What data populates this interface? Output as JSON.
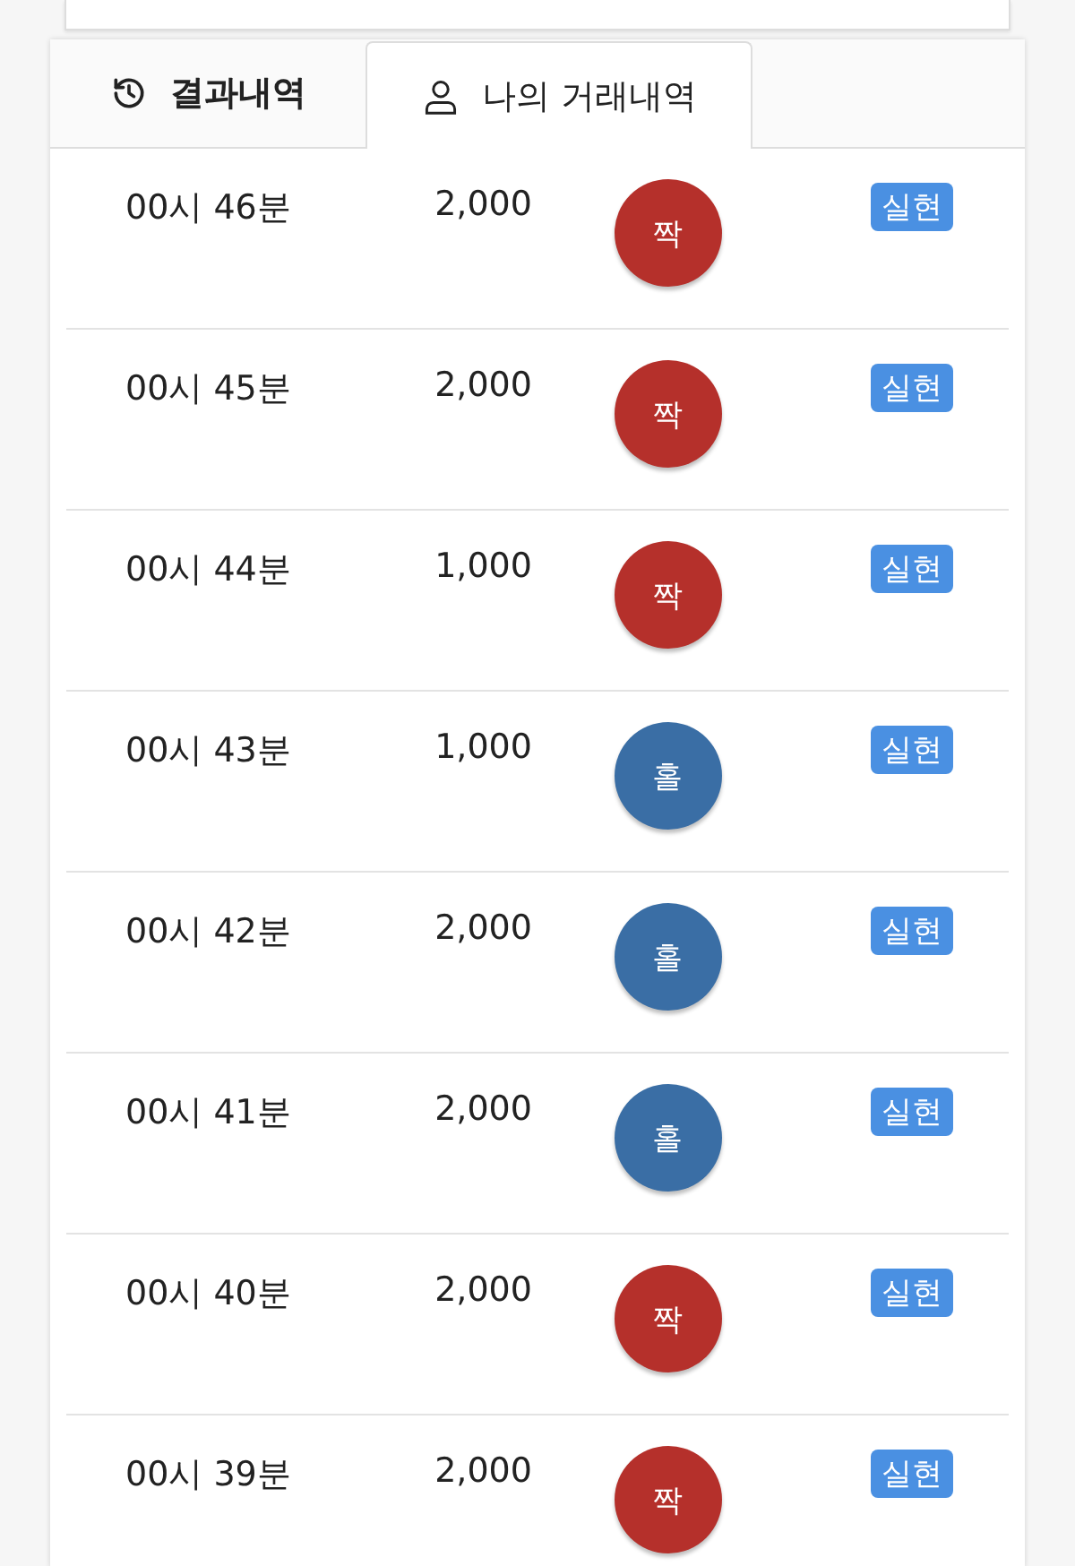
{
  "tabs": [
    {
      "label": "결과내역",
      "kind": "history",
      "selected": false
    },
    {
      "label": "나의 거래내역",
      "kind": "person",
      "selected": true
    }
  ],
  "rows": [
    {
      "time": "00시 46분",
      "amount": "2,000",
      "result": "짝",
      "kind": "even",
      "status": "실현"
    },
    {
      "time": "00시 45분",
      "amount": "2,000",
      "result": "짝",
      "kind": "even",
      "status": "실현"
    },
    {
      "time": "00시 44분",
      "amount": "1,000",
      "result": "짝",
      "kind": "even",
      "status": "실현"
    },
    {
      "time": "00시 43분",
      "amount": "1,000",
      "result": "홀",
      "kind": "odd",
      "status": "실현"
    },
    {
      "time": "00시 42분",
      "amount": "2,000",
      "result": "홀",
      "kind": "odd",
      "status": "실현"
    },
    {
      "time": "00시 41분",
      "amount": "2,000",
      "result": "홀",
      "kind": "odd",
      "status": "실현"
    },
    {
      "time": "00시 40분",
      "amount": "2,000",
      "result": "짝",
      "kind": "even",
      "status": "실현"
    },
    {
      "time": "00시 39분",
      "amount": "2,000",
      "result": "짝",
      "kind": "even",
      "status": "실현"
    }
  ]
}
